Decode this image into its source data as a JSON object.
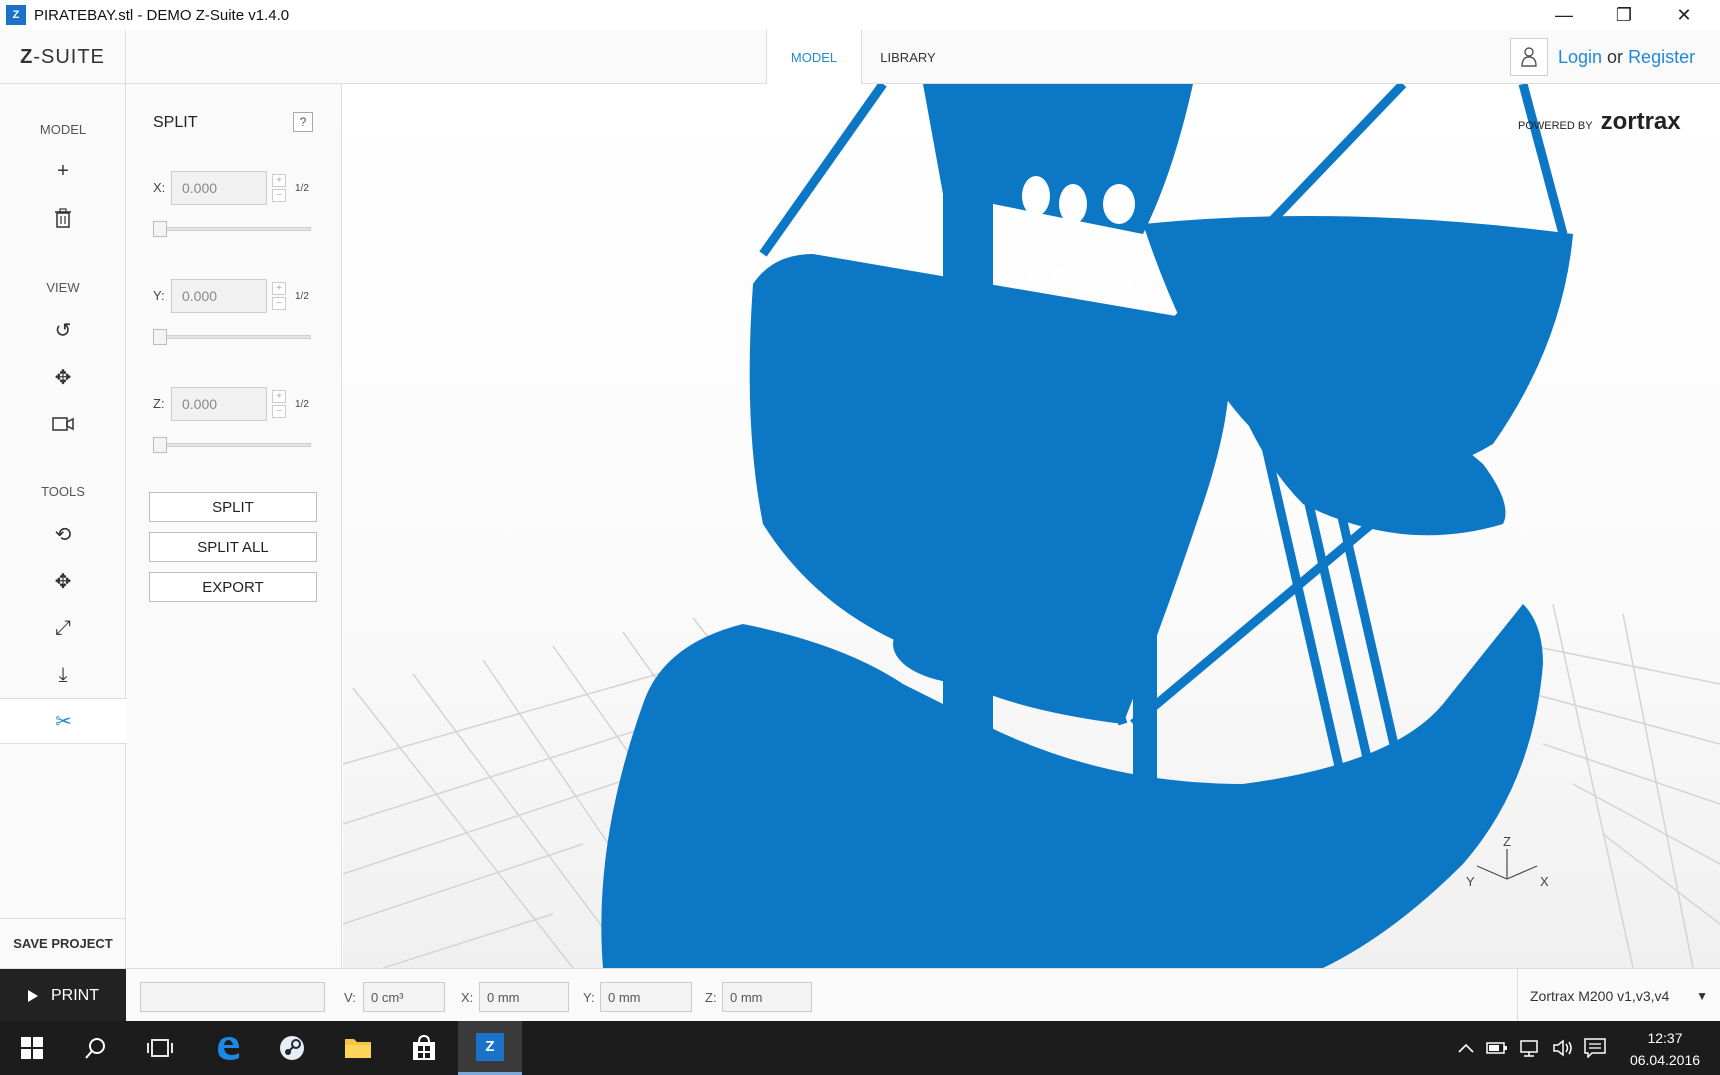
{
  "window": {
    "title": "PIRATEBAY.stl - DEMO Z-Suite v1.4.0",
    "icon_letter": "Z",
    "minimize_glyph": "—",
    "restore_glyph": "❐",
    "close_glyph": "✕"
  },
  "header": {
    "logo_bold": "Z",
    "logo_rest": "-SUITE",
    "tabs": [
      {
        "label": "MODEL",
        "active": true
      },
      {
        "label": "LIBRARY",
        "active": false
      }
    ],
    "login_label": "Login",
    "or_label": "or",
    "register_label": "Register"
  },
  "sidebar": {
    "sections": {
      "model": "MODEL",
      "view": "VIEW",
      "tools": "TOOLS"
    },
    "buttons": {
      "add": "+",
      "delete": "🗑",
      "rotate_view": "↺",
      "pan_view": "✥",
      "camera": "📷",
      "rotate_tool": "⟲",
      "move_tool": "✥",
      "scale_tool": "⤢",
      "place_tool": "⤓",
      "split_tool": "✂"
    },
    "save_project": "SAVE PROJECT"
  },
  "split_panel": {
    "title": "SPLIT",
    "help": "?",
    "axes": [
      {
        "label": "X:",
        "value": "0.000",
        "half": "1/2"
      },
      {
        "label": "Y:",
        "value": "0.000",
        "half": "1/2"
      },
      {
        "label": "Z:",
        "value": "0.000",
        "half": "1/2"
      }
    ],
    "plus": "+",
    "minus": "−",
    "split_button": "SPLIT",
    "split_all_button": "SPLIT ALL",
    "export_button": "EXPORT"
  },
  "viewport": {
    "powered_by": "POWERED BY",
    "brand": "zortrax",
    "axis_z": "Z",
    "axis_y": "Y",
    "axis_x": "X",
    "model_color": "#0a78c8"
  },
  "bottom": {
    "print_label": "PRINT",
    "v_label": "V:",
    "v_value": "0 cm³",
    "x_label": "X:",
    "x_value": "0 mm",
    "y_label": "Y:",
    "y_value": "0 mm",
    "z_label": "Z:",
    "z_value": "0 mm",
    "printer": "Zortrax M200 v1,v3,v4",
    "printer_caret": "▼"
  },
  "taskbar": {
    "app_letter": "Z",
    "time": "12:37",
    "date": "06.04.2016"
  }
}
